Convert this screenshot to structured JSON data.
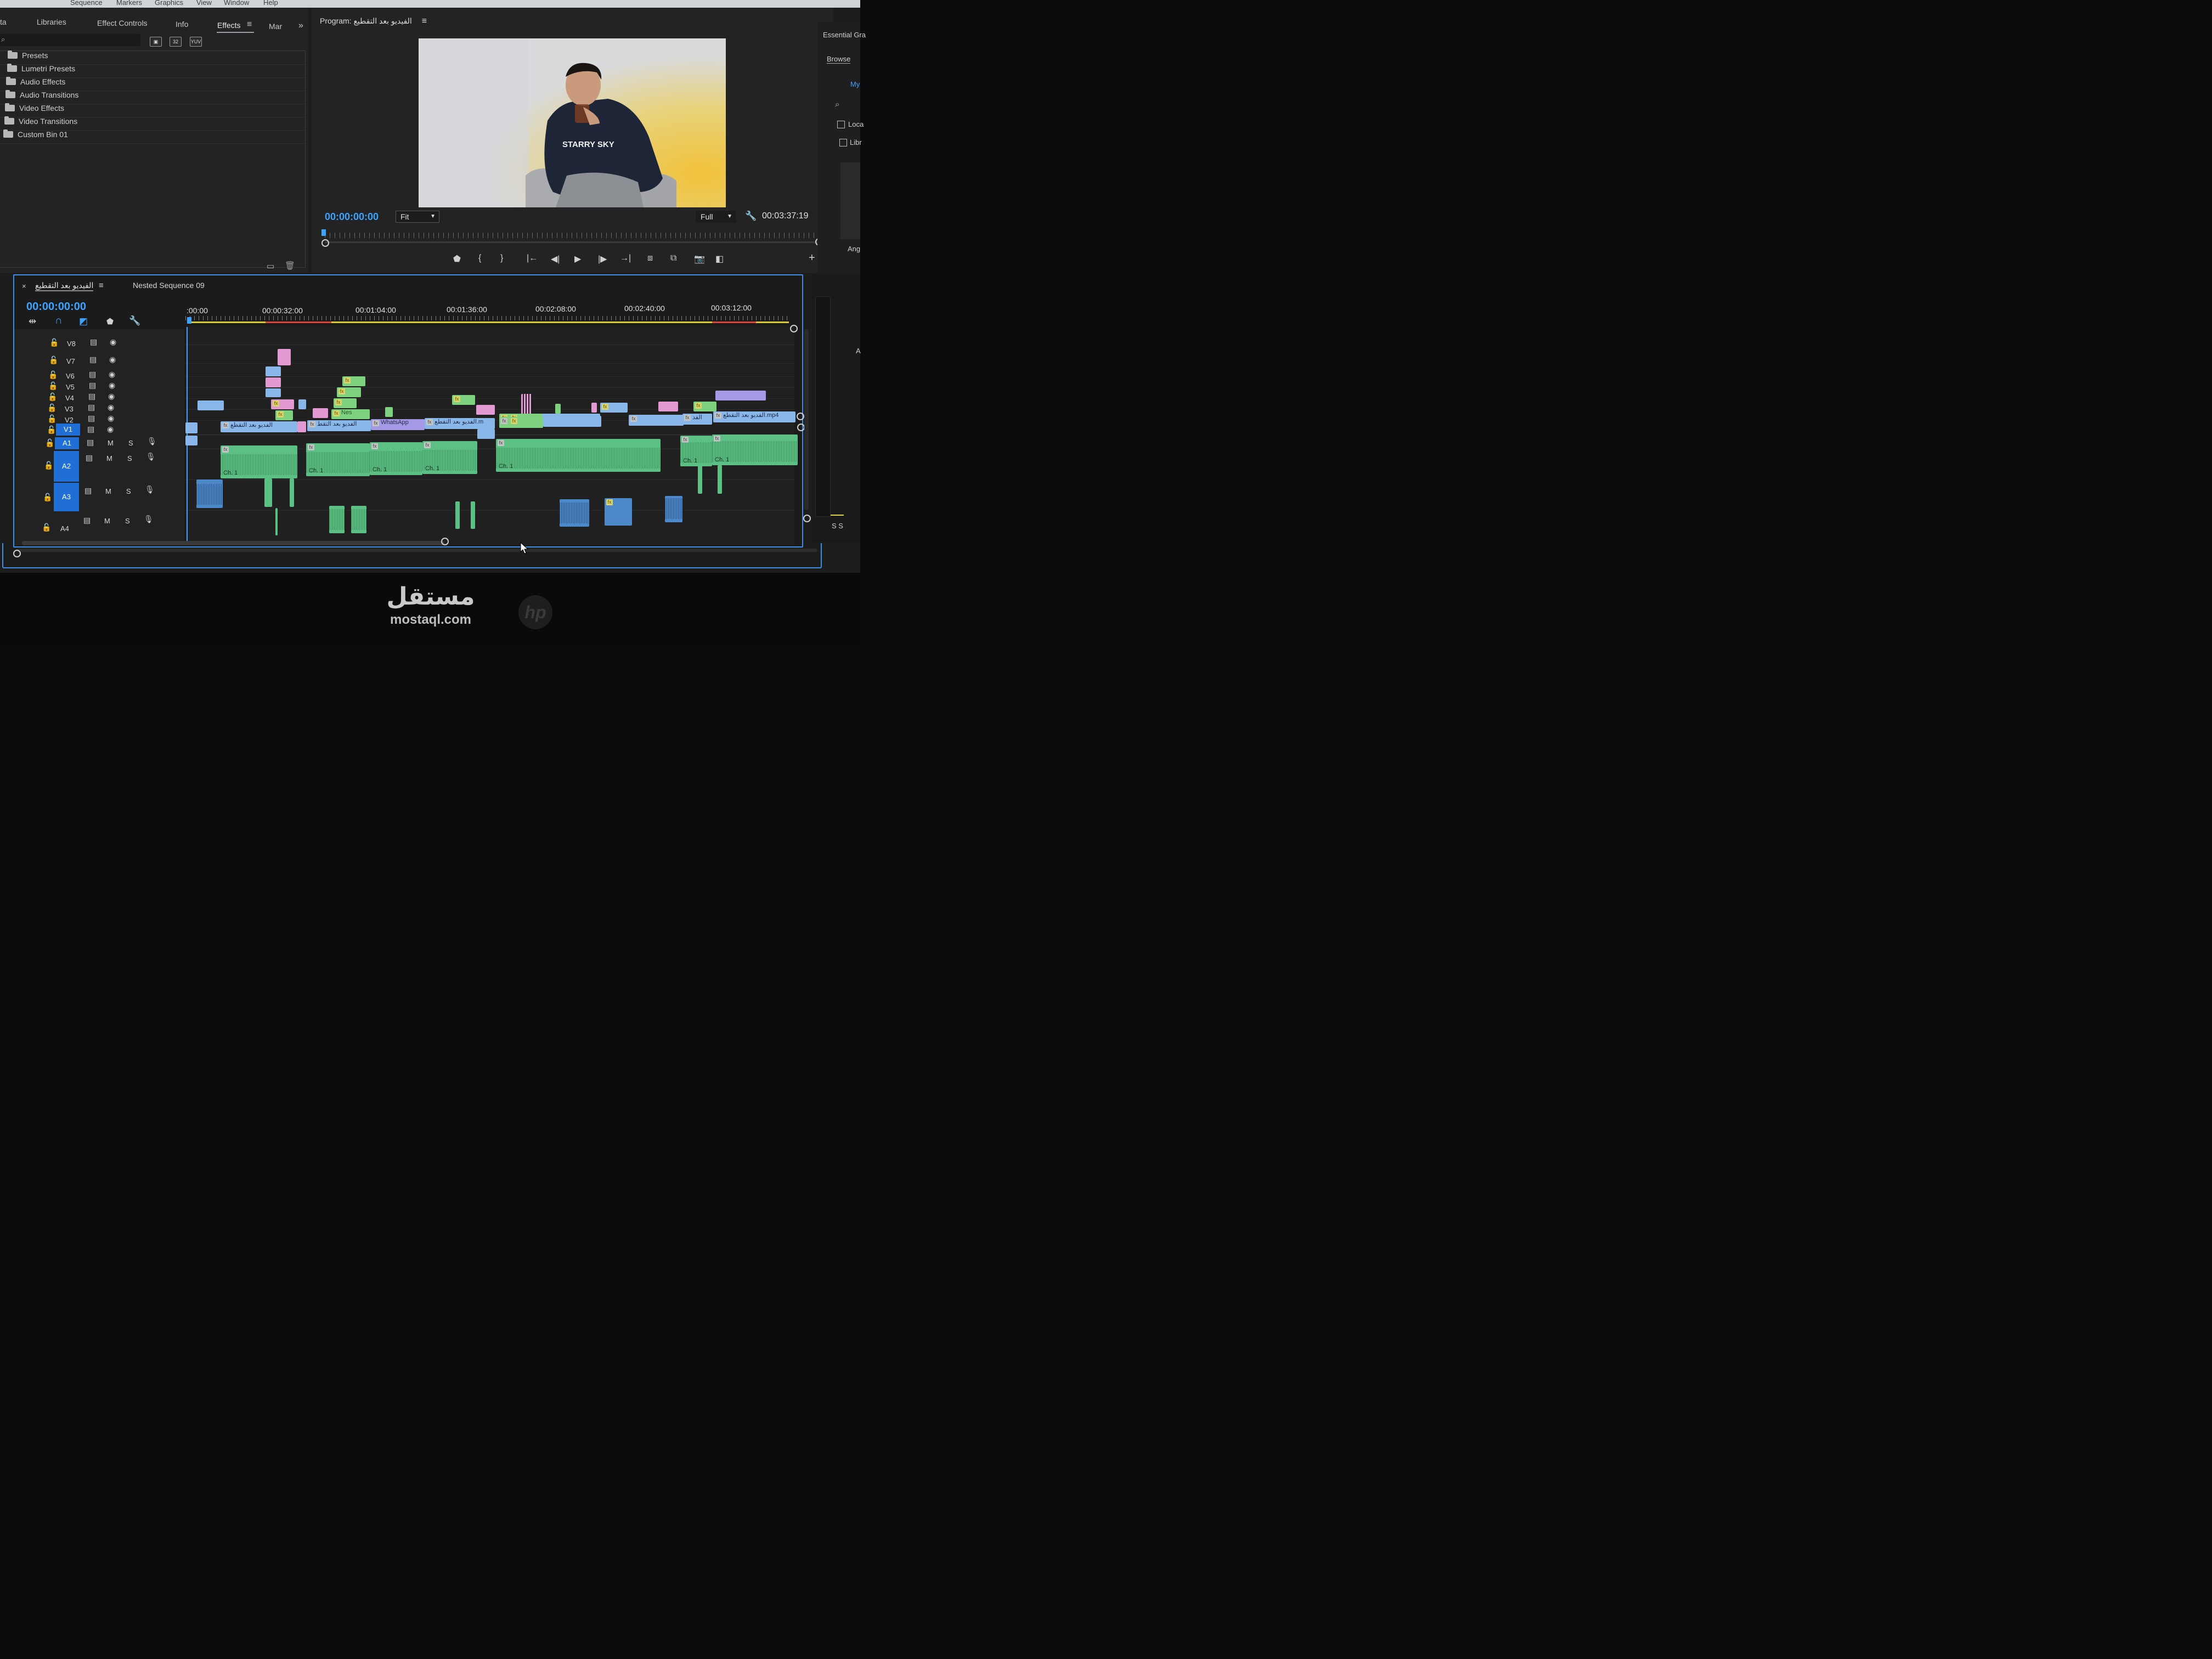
{
  "os_menu": [
    "Sequence",
    "Markers",
    "Graphics",
    "View",
    "Window",
    "Help"
  ],
  "top_panel": {
    "tabs": [
      {
        "label": "ta"
      },
      {
        "label": "Libraries"
      },
      {
        "label": "Effect Controls"
      },
      {
        "label": "Info"
      },
      {
        "label": "Effects"
      },
      {
        "label": "Mar"
      }
    ],
    "active_tab": "Effects",
    "toolbar_icons": [
      "accelerated-effects-icon",
      "32-bit-icon",
      "yuv-icon"
    ],
    "toolbar_labels": [
      "32",
      "YUV"
    ],
    "bins": [
      "Presets",
      "Lumetri Presets",
      "Audio Effects",
      "Audio Transitions",
      "Video Effects",
      "Video Transitions",
      "Custom Bin 01"
    ]
  },
  "program": {
    "title": "Program: الفيديو بعد التقطيع",
    "timecode": "00:00:00:00",
    "fit": "Fit",
    "quality": "Full",
    "duration": "00:03:37:19",
    "hoodie_text": "STARRY SKY"
  },
  "essential": {
    "title": "Essential Gra",
    "browse": "Browse",
    "my": "My",
    "check1": "Loca",
    "check2": "Libr",
    "ang": "Ang",
    "a": "A",
    "ss": "S S"
  },
  "timeline": {
    "tab_active": "الفيديو بعد التقطيع",
    "tab_nested": "Nested Sequence 09",
    "timecode": "00:00:00:00",
    "ruler": [
      ":00:00",
      "00:00:32:00",
      "00:01:04:00",
      "00:01:36:00",
      "00:02:08:00",
      "00:02:40:00",
      "00:03:12:00"
    ],
    "video_tracks": [
      "V8",
      "V7",
      "V6",
      "V5",
      "V4",
      "V3",
      "V2",
      "V1"
    ],
    "audio_tracks": [
      "A1",
      "A2",
      "A3",
      "A4"
    ],
    "mute": "M",
    "solo": "S",
    "clip_labels": {
      "v1_a": "الفديو بعد التقطع",
      "v1_b": "الفديو بعد التقط",
      "v1_c": "WhatsApp",
      "v1_d": "الفديو بعد التقطع.m",
      "v1_e": "الفد",
      "v1_f": "الفديو بعد التقطع.mp4",
      "v2_nes": "Nes",
      "ch": "Ch. 1"
    }
  },
  "watermark": {
    "arabic": "مستقل",
    "latin": "mostaql.com"
  },
  "brand": "hp"
}
